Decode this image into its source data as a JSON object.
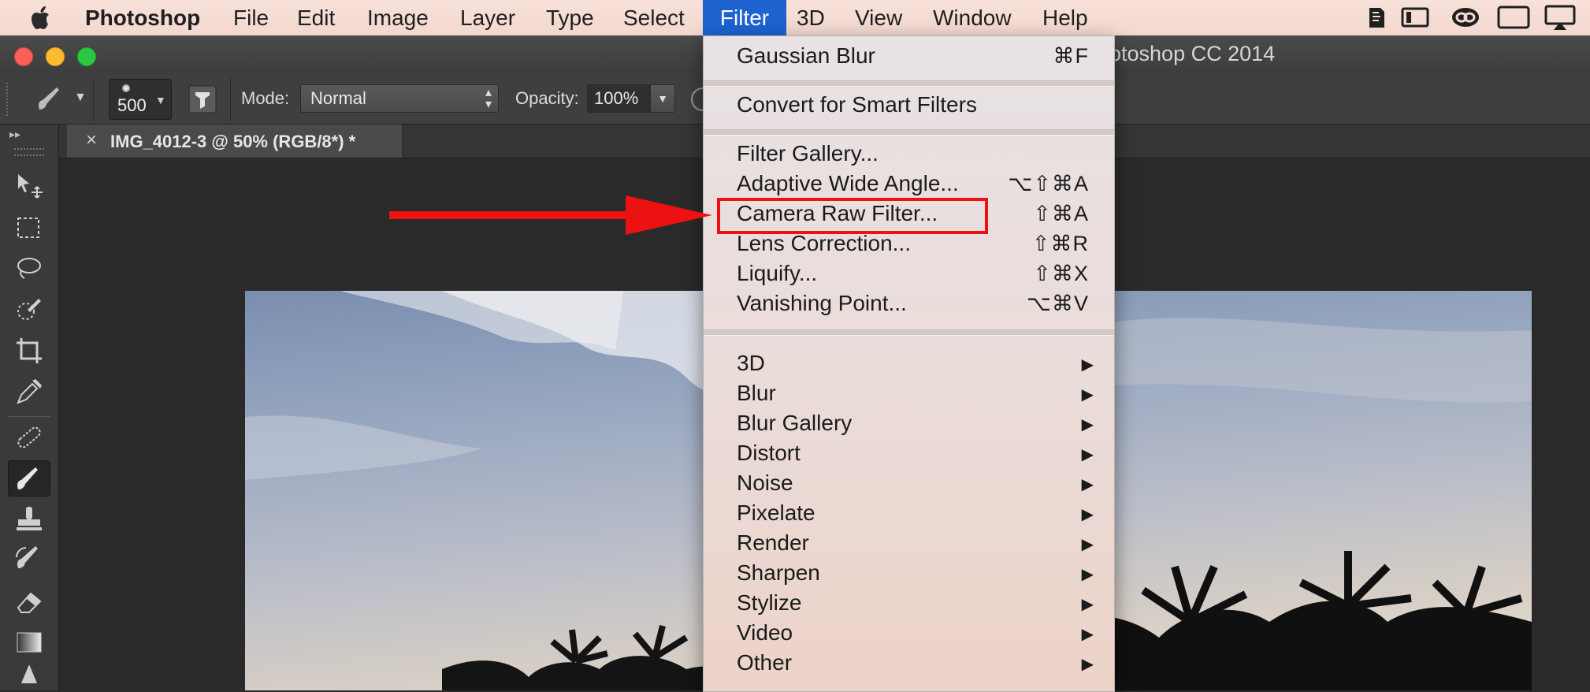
{
  "menubar": {
    "apple_label": "",
    "items": [
      {
        "label": "Photoshop"
      },
      {
        "label": "File"
      },
      {
        "label": "Edit"
      },
      {
        "label": "Image"
      },
      {
        "label": "Layer"
      },
      {
        "label": "Type"
      },
      {
        "label": "Select"
      },
      {
        "label": "Filter"
      },
      {
        "label": "3D"
      },
      {
        "label": "View"
      },
      {
        "label": "Window"
      },
      {
        "label": "Help"
      }
    ],
    "status_icons": [
      "evernote-icon",
      "dashboard-icon",
      "creative-cloud-icon",
      "display-icon",
      "airplay-icon"
    ]
  },
  "window": {
    "title": "otoshop CC 2014"
  },
  "options_bar": {
    "brush_size": "500",
    "mode_label": "Mode:",
    "mode_value": "Normal",
    "opacity_label": "Opacity:",
    "opacity_value": "100%"
  },
  "document": {
    "tab_close": "×",
    "tab_title": "IMG_4012-3 @ 50% (RGB/8*) *"
  },
  "tools": [
    "move-tool",
    "marquee-tool",
    "lasso-tool",
    "quick-selection-tool",
    "crop-tool",
    "eyedropper-tool",
    "healing-brush-tool",
    "brush-tool",
    "clone-stamp-tool",
    "history-brush-tool",
    "eraser-tool",
    "gradient-tool",
    "pen-tool"
  ],
  "filter_menu": {
    "last_filter": {
      "label": "Gaussian Blur",
      "shortcut": "⌘F"
    },
    "convert": {
      "label": "Convert for Smart Filters"
    },
    "group_items": [
      {
        "label": "Filter Gallery...",
        "shortcut": ""
      },
      {
        "label": "Adaptive Wide Angle...",
        "shortcut": "⌥⇧⌘A"
      },
      {
        "label": "Camera Raw Filter...",
        "shortcut": "⇧⌘A"
      },
      {
        "label": "Lens Correction...",
        "shortcut": "⇧⌘R"
      },
      {
        "label": "Liquify...",
        "shortcut": "⇧⌘X"
      },
      {
        "label": "Vanishing Point...",
        "shortcut": "⌥⌘V"
      }
    ],
    "submenus": [
      {
        "label": "3D"
      },
      {
        "label": "Blur"
      },
      {
        "label": "Blur Gallery"
      },
      {
        "label": "Distort"
      },
      {
        "label": "Noise"
      },
      {
        "label": "Pixelate"
      },
      {
        "label": "Render"
      },
      {
        "label": "Sharpen"
      },
      {
        "label": "Stylize"
      },
      {
        "label": "Video"
      },
      {
        "label": "Other"
      }
    ],
    "submenu_arrow": "▶"
  },
  "annotation": {
    "highlight_color": "#ee1111",
    "highlighted_item": "Camera Raw Filter..."
  }
}
